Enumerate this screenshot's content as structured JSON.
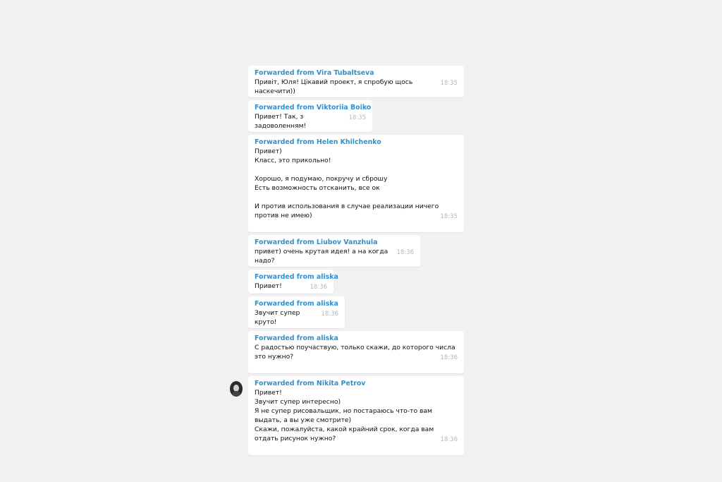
{
  "messages": [
    {
      "from": "Forwarded from Vira Tubaltseva",
      "text": "Привіт, Юля! Цікавий проект, я спробую щось наскечити))",
      "time": "18:35"
    },
    {
      "from": "Forwarded from Viktoriia Boiko",
      "text": "Привет! Так, з задоволенням!",
      "time": "18:35"
    },
    {
      "from": "Forwarded from Helen Khilchenko",
      "text": "Привет)\nКласс, это прикольно!\n\nХорошо, я подумаю, покручу и сброшу\nЕсть возможность отсканить, все ок\n\nИ против использования в случае реализации ничего против не имею)",
      "time": "18:35"
    },
    {
      "from": "Forwarded from Liubov Vanzhula",
      "text": "привет) очень крутая идея! а на когда надо?",
      "time": "18:36"
    },
    {
      "from": "Forwarded from aliska",
      "text": "Привет!",
      "time": "18:36"
    },
    {
      "from": "Forwarded from aliska",
      "text": "Звучит супер круто!",
      "time": "18:36"
    },
    {
      "from": "Forwarded from aliska",
      "text": "С радостью поучаствую, только скажи, до которого числа это нужно?",
      "time": "18:36"
    },
    {
      "from": "Forwarded from Nikita Petrov",
      "text": "Привет!\nЗвучит супер интересно)\nЯ не супер рисовальщик, но постараюсь что-то вам выдать, а вы уже смотрите)\nСкажи, пожалуйста, какой крайний срок, когда вам отдать рисунок нужно?",
      "time": "18:36"
    }
  ]
}
